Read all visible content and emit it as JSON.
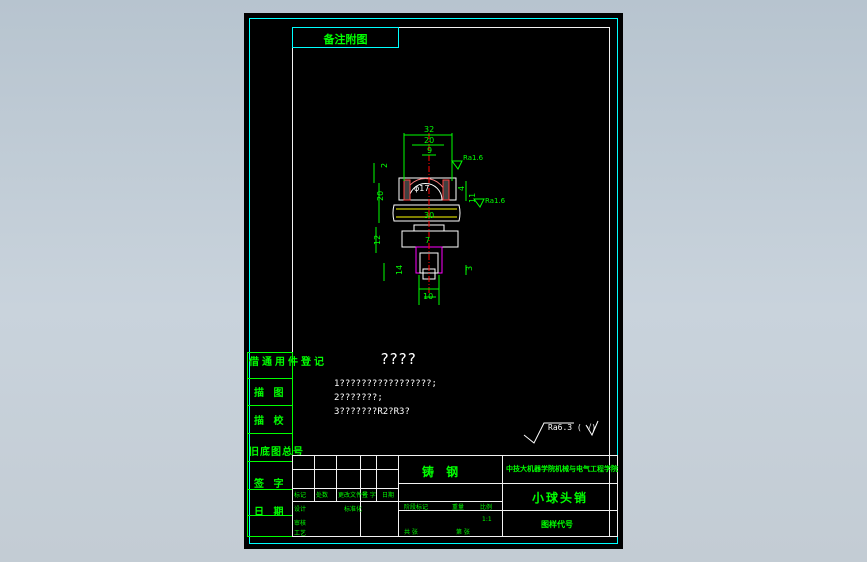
{
  "drawing": {
    "top_tag": "备注附图",
    "left_column": [
      "借通用件登记",
      "描 图",
      "描 校",
      "旧底图总号",
      "签 字",
      "日 期"
    ],
    "tech_title": "????",
    "tech_notes": [
      "1?????????????????;",
      "2???????;",
      "3???????R2?R3?"
    ],
    "roughness_note": "Ra6.3 (  √)",
    "title_block": {
      "material": "铸 钢",
      "school": "中技大机器学院机械与电气工程学院",
      "part_name": "小球头销",
      "drawing_code": "图样代号",
      "marks": "标记",
      "count": "处数",
      "change_doc": "更改文件号",
      "signature": "签 字",
      "date": "日期",
      "designer": "设计",
      "standardization": "标准化",
      "stage_mark": "阶段标记",
      "weight": "重量",
      "ratio_label": "比例",
      "ratio_value": "1:1",
      "reviewer": "审核",
      "process": "工艺",
      "sheets_total": "共 张",
      "sheet_no": "第 张"
    },
    "dims": {
      "d32": "32",
      "d20": "20",
      "d9": "9",
      "d2": "2",
      "d20v": "20",
      "d4": "4",
      "d11": "11",
      "d30": "30",
      "d12": "12",
      "d7": "7",
      "d14": "14",
      "d3": "3",
      "d10": "10",
      "dphi17": "φ17",
      "ra1": "Ra1.6",
      "ra2": "Ra1.6"
    }
  }
}
